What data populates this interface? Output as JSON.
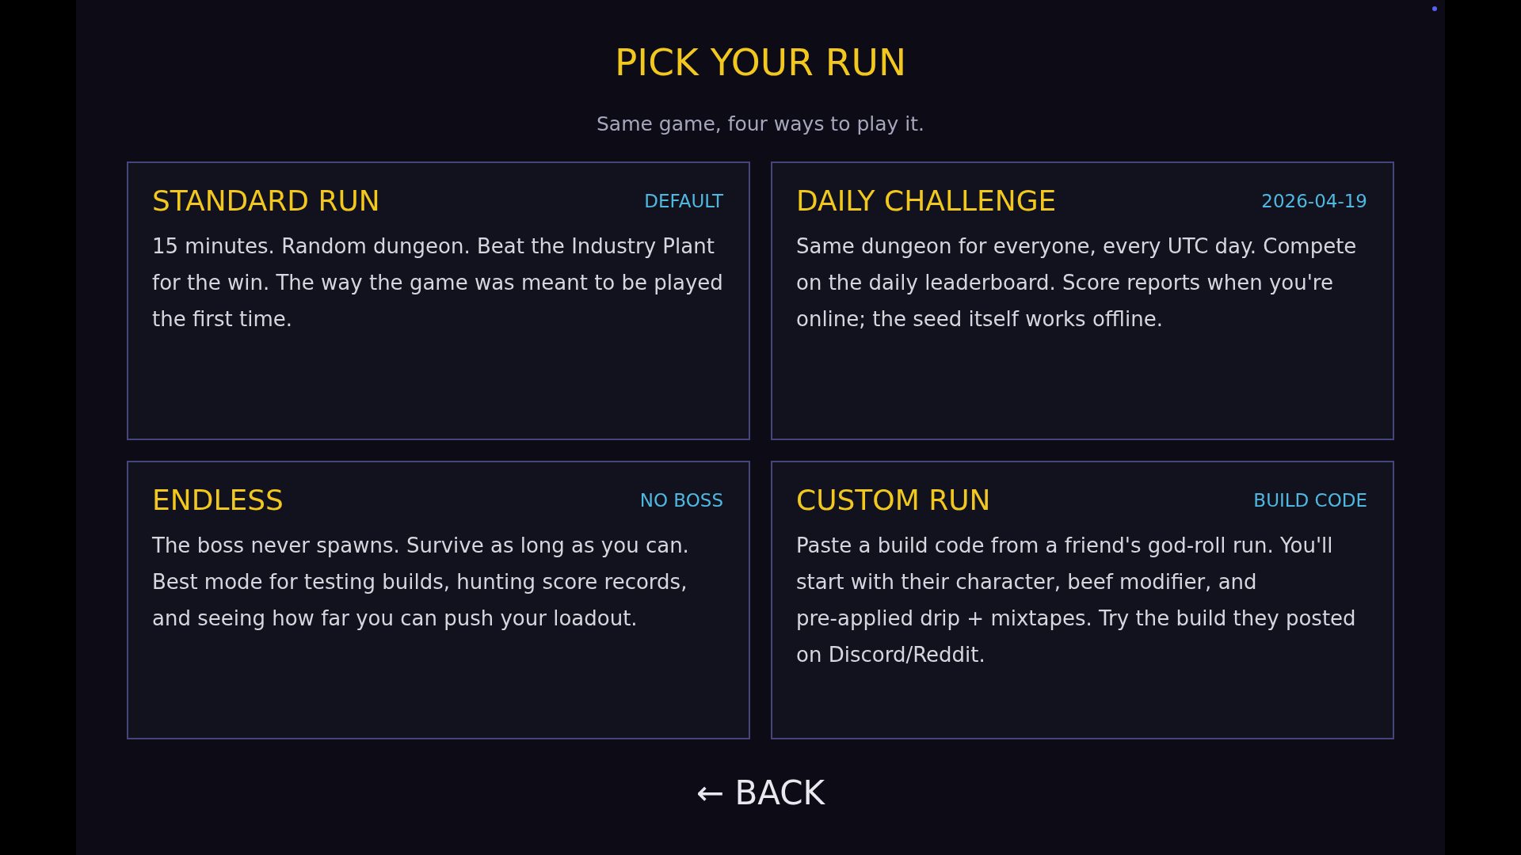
{
  "screen": {
    "title": "PICK YOUR RUN",
    "subtitle": "Same game, four ways to play it."
  },
  "modes": [
    {
      "title": "STANDARD RUN",
      "tag": "DEFAULT",
      "description": "15 minutes. Random dungeon. Beat the Industry Plant for the win. The way the game was meant to be played the first time."
    },
    {
      "title": "DAILY CHALLENGE",
      "tag": "2026-04-19",
      "description": "Same dungeon for everyone, every UTC day. Compete on the daily leaderboard. Score reports when you're online; the seed itself works offline."
    },
    {
      "title": "ENDLESS",
      "tag": "NO BOSS",
      "description": "The boss never spawns. Survive as long as you can. Best mode for testing builds, hunting score records, and seeing how far you can push your loadout."
    },
    {
      "title": "CUSTOM RUN",
      "tag": "BUILD CODE",
      "description": "Paste a build code from a friend's god-roll run. You'll start with their character, beef modifier, and pre-applied drip + mixtapes. Try the build they posted on Discord/Reddit."
    }
  ],
  "back_button": {
    "label": "← BACK"
  }
}
